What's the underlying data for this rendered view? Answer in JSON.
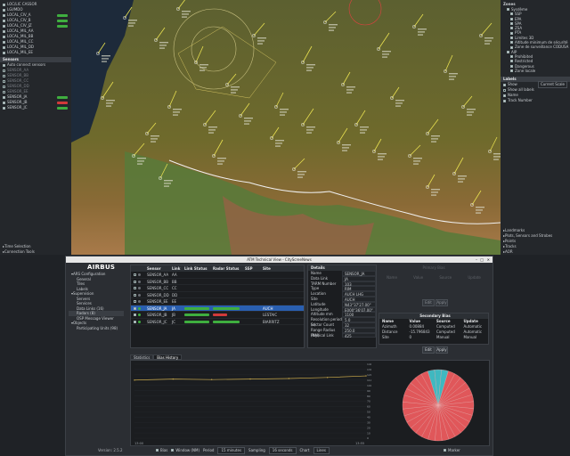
{
  "top_left": {
    "tree_items": [
      "LOC/LIC CASSOR",
      "LGI/MDO",
      "LOCAL_CIV_A",
      "LOCAL_CIV_B",
      "LOCAL_CIV_JZ",
      "LOCAL_MIL_AA",
      "LOCAL_MIL_BB",
      "LOCAL_MIL_CC",
      "LOCAL_MIL_DD",
      "LOCAL_MIL_EE"
    ],
    "sensors_title": "Sensors",
    "auto_connect": "Auto connect sensors",
    "sensors": [
      "SENSOR_AA",
      "SENSOR_BB",
      "SENSOR_CC",
      "SENSOR_DD",
      "SENSOR_EE",
      "SENSOR_JA",
      "SENSOR_JB",
      "SENSOR_JC"
    ],
    "time_selection": "Time Selection",
    "connection_tools": "Connection Tools"
  },
  "right_panel": {
    "zones_title": "Zones",
    "zone_items": [
      "Sysdème",
      "SSP",
      "EPA",
      "SPA",
      "ZSA",
      "PTA",
      "Limites 3D",
      "Altitude minimum de sécurité",
      "Zone de surveillance CODUSA",
      "AIP",
      "Prohibited",
      "Restricted",
      "Dangerous",
      "Zone locale"
    ],
    "labels_title": "Labels",
    "show": "Show",
    "current_scale": "Current Scale",
    "show_all_labels": "Show all labels",
    "name": "Name",
    "track_number": "Track Number",
    "bottom_items": [
      "Landmarks",
      "Plots, Sensors and Strobes",
      "Points",
      "Tracks",
      "AOR"
    ]
  },
  "window": {
    "title": "ATM Technical View - CityScreeNews",
    "logo": "AIRBUS",
    "nav": [
      {
        "label": "ARS Configuration",
        "level": 0
      },
      {
        "label": "General",
        "level": 1
      },
      {
        "label": "Tiles",
        "level": 1
      },
      {
        "label": "Labels",
        "level": 1
      },
      {
        "label": "Supervision",
        "level": 0
      },
      {
        "label": "Servers",
        "level": 1
      },
      {
        "label": "Services",
        "level": 1
      },
      {
        "label": "Data Links (16)",
        "level": 1
      },
      {
        "label": "Radars (8)",
        "level": 1
      },
      {
        "label": "OSP Message Viewer",
        "level": 1
      },
      {
        "label": "Objects",
        "level": 0
      },
      {
        "label": "Participating Units (98)",
        "level": 1
      }
    ],
    "version": "Version: 2.5.2",
    "table": {
      "headers": [
        "",
        "",
        "Sensor",
        "Link",
        "Link Status",
        "Radar Status",
        "SSP",
        "Site"
      ],
      "rows": [
        {
          "sensor": "SENSOR_AA",
          "link": "AA",
          "ssp": "",
          "site": ""
        },
        {
          "sensor": "SENSOR_BB",
          "link": "BB",
          "ssp": "",
          "site": ""
        },
        {
          "sensor": "SENSOR_CC",
          "link": "CC",
          "ssp": "",
          "site": ""
        },
        {
          "sensor": "SENSOR_DD",
          "link": "DD",
          "ssp": "",
          "site": ""
        },
        {
          "sensor": "SENSOR_EE",
          "link": "EE",
          "ssp": "",
          "site": ""
        },
        {
          "sensor": "SENSOR_JA",
          "link": "JA",
          "ssp": "",
          "site": "AUCH"
        },
        {
          "sensor": "SENSOR_JB",
          "link": "JB",
          "ssp": "",
          "site": "LESTAIC"
        },
        {
          "sensor": "SENSOR_JC",
          "link": "JC",
          "ssp": "",
          "site": "BIARRITZ"
        }
      ]
    },
    "details": {
      "title": "Details",
      "rows": [
        [
          "Name",
          "SENSOR_JA"
        ],
        [
          "Data Link",
          "JA"
        ],
        [
          "TARM Number",
          "103"
        ],
        [
          "Type",
          "RIM"
        ],
        [
          "Location",
          "AUCH LHG"
        ],
        [
          "Site",
          "AUCH"
        ],
        [
          "Latitude",
          "N43°37'27.00\""
        ],
        [
          "Longitude",
          "E000°36'07.00\""
        ],
        [
          "Altitude mm",
          "1100"
        ],
        [
          "Resolution period (s)",
          "5.0"
        ],
        [
          "Sector Count",
          "32"
        ],
        [
          "Range Radius (NM)",
          "250.0"
        ],
        [
          "Physical Link",
          "425"
        ]
      ]
    },
    "actions": {
      "edit": "Edit",
      "apply": "Apply",
      "edit2": "Edit",
      "apply2": "Apply"
    },
    "secondary_bias": {
      "title": "Secondary Bias",
      "headers": [
        "Name",
        "Value",
        "Source",
        "Update"
      ],
      "rows": [
        [
          "Azimuth",
          "0.00884",
          "Computed",
          "Automatic"
        ],
        [
          "Distance",
          "-15.796843",
          "Computed",
          "Automatic"
        ],
        [
          "Site",
          "0",
          "Manual",
          "Manual"
        ]
      ]
    },
    "greyed": {
      "row1": [
        "Primary Bias"
      ],
      "labels": [
        "Name",
        "Value",
        "Source",
        "Update"
      ]
    },
    "tabs": [
      "Statistics",
      "Bias History"
    ],
    "yaxis_right": [
      "140",
      "130",
      "120",
      "110",
      "100",
      "90",
      "80",
      "70",
      "60",
      "50",
      "40",
      "30",
      "20",
      "10",
      "0"
    ],
    "xaxis": [
      "13:00",
      "13:55"
    ],
    "bottom_bar": {
      "bias_label": "Bias",
      "window_label": "Window (NM)",
      "period_label": "Period",
      "period_value": "15 minutes",
      "sampling_label": "Sampling",
      "sampling_value": "16 seconds",
      "chart_label": "Chart",
      "chart_value": "Lines",
      "marker": "Marker"
    }
  },
  "chart_data": [
    {
      "type": "line",
      "title": "",
      "xlabel": "",
      "ylabel": "",
      "ylim": [
        0,
        140
      ],
      "x": [
        "13:00",
        "13:10",
        "13:20",
        "13:30",
        "13:40",
        "13:50",
        "13:55"
      ],
      "series": [
        {
          "values": [
            110,
            112,
            111,
            112,
            113,
            115,
            118
          ]
        }
      ]
    },
    {
      "type": "pie",
      "values": [
        3,
        29
      ],
      "categories": [
        "",
        ""
      ]
    }
  ]
}
